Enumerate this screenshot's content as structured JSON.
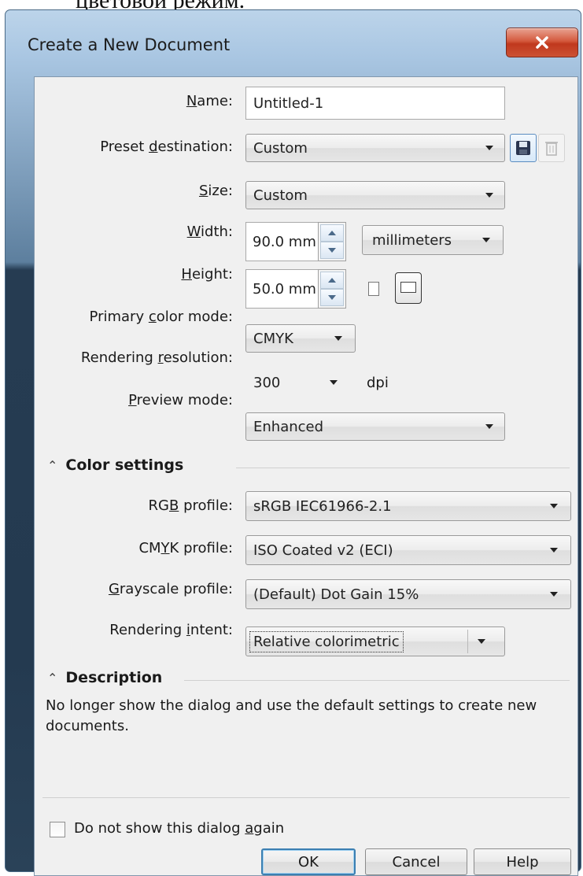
{
  "caption": "цветовой режим.",
  "window": {
    "title": "Create a New Document"
  },
  "fields": {
    "name": {
      "label_pre": "",
      "label_key": "N",
      "label_post": "ame:",
      "value": "Untitled-1"
    },
    "preset": {
      "label_pre": "Preset ",
      "label_key": "d",
      "label_post": "estination:",
      "value": "Custom"
    },
    "size": {
      "label_pre": "",
      "label_key": "S",
      "label_post": "ize:",
      "value": "Custom"
    },
    "width": {
      "label_pre": "",
      "label_key": "W",
      "label_post": "idth:",
      "value": "90.0 mm",
      "units": "millimeters"
    },
    "height": {
      "label_pre": "",
      "label_key": "H",
      "label_post": "eight:",
      "value": "50.0 mm"
    },
    "color_mode": {
      "label_pre": "Primary ",
      "label_key": "c",
      "label_post": "olor mode:",
      "value": "CMYK"
    },
    "resolution": {
      "label_pre": "Rendering ",
      "label_key": "r",
      "label_post": "esolution:",
      "value": "300",
      "unit": "dpi"
    },
    "preview": {
      "label_pre": "",
      "label_key": "P",
      "label_post": "review mode:",
      "value": "Enhanced"
    }
  },
  "color_settings": {
    "heading": "Color settings",
    "rgb": {
      "label_pre": "RG",
      "label_key": "B",
      "label_post": " profile:",
      "value": "sRGB IEC61966-2.1"
    },
    "cmyk": {
      "label_pre": "CM",
      "label_key": "Y",
      "label_post": "K profile:",
      "value": "ISO Coated v2 (ECI)"
    },
    "gray": {
      "label_pre": "",
      "label_key": "G",
      "label_post": "rayscale profile:",
      "value": "(Default) Dot Gain 15%"
    },
    "intent": {
      "label_pre": "Rendering ",
      "label_key": "i",
      "label_post": "ntent:",
      "value": "Relative colorimetric"
    }
  },
  "description": {
    "heading": "Description",
    "text": "No longer show the dialog and use the default settings to create new documents."
  },
  "dont_show": {
    "label_pre": "Do not show this dialog ",
    "label_key": "a",
    "label_post": "gain",
    "checked": false
  },
  "buttons": {
    "ok": "OK",
    "cancel": "Cancel",
    "help": "Help"
  },
  "icons": {
    "close": "close-icon",
    "save": "save-preset-icon",
    "delete": "delete-preset-icon",
    "portrait": "portrait-icon",
    "landscape": "landscape-icon",
    "collapse": "collapse-chevron-icon"
  }
}
